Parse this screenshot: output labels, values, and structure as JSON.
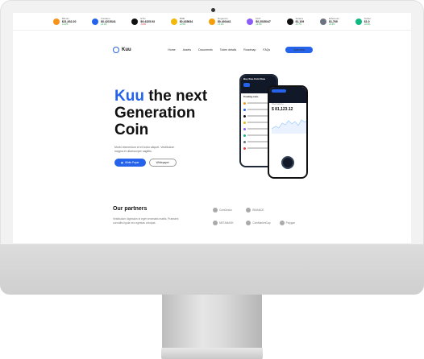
{
  "ticker": [
    {
      "icon": "bitcoin-icon",
      "color": "#f7931a",
      "name": "Bitcoin",
      "price": "$21,932.20",
      "change": "+1.2%",
      "neg": false
    },
    {
      "icon": "cardano-icon",
      "color": "#2563eb",
      "name": "Cardano",
      "price": "$0.4215341",
      "change": "+2.1%",
      "neg": false
    },
    {
      "icon": "ethereum-dark-icon",
      "color": "#111111",
      "name": "ETH",
      "price": "$9.4325.93",
      "change": "-0.8%",
      "neg": true
    },
    {
      "icon": "binance-icon",
      "color": "#f0b90b",
      "name": "BNB",
      "price": "$0.435634",
      "change": "+0.5%",
      "neg": false
    },
    {
      "icon": "dogecoin-icon",
      "color": "#f59e0b",
      "name": "Dogecoin",
      "price": "$0.403441",
      "change": "+1.1%",
      "neg": false
    },
    {
      "icon": "polkadot-icon",
      "color": "#8b5cf6",
      "name": "DOT",
      "price": "$0.2035347",
      "change": "+0.9%",
      "neg": false
    },
    {
      "icon": "solana-icon",
      "color": "#111111",
      "name": "Solana",
      "price": "$1.109",
      "change": "+1.7%",
      "neg": false
    },
    {
      "icon": "ethereum-icon",
      "color": "#6b7280",
      "name": "Ethereum",
      "price": "$1,769",
      "change": "+0.3%",
      "neg": false
    },
    {
      "icon": "tether-icon",
      "color": "#10b981",
      "name": "Tether",
      "price": "$1.0",
      "change": "+0.0%",
      "neg": false
    }
  ],
  "nav": {
    "logo": "Kuu",
    "items": [
      "Home",
      "Assets",
      "Documents",
      "Token details",
      "Roadmap",
      "FAQs"
    ],
    "cta": "Join now"
  },
  "hero": {
    "title_accent": "Kuu",
    "title_rest_1": " the next",
    "title_rest_2": "Generation",
    "title_rest_3": "Coin",
    "description": "Morbi elementum et et tortor aliquet. Vestibulum magna et ullamcorper sagittis.",
    "primary_btn": "White Paper",
    "secondary_btn": "Whitepaper"
  },
  "phone_back": {
    "head": "Buy Kuu Coin Now",
    "list_title": "Trending coins"
  },
  "phone_front": {
    "price": "$ 81,123.12",
    "sub": "Total balance"
  },
  "partners": {
    "title": "Our partners",
    "description": "Vestibulum dignissim in eget venenatis mattis. Praesent convallis ligula nec egestas volutpat.",
    "logos": [
      {
        "name": "CoinGecko",
        "icon": "coingecko-icon"
      },
      {
        "name": "BINANCE",
        "icon": "binance-logo-icon"
      },
      {
        "name": "",
        "icon": "blank"
      },
      {
        "name": "METAMASK",
        "icon": "metamask-icon"
      },
      {
        "name": "CoinMarketCap",
        "icon": "coinmarketcap-icon"
      },
      {
        "name": "Polygon",
        "icon": "polygon-icon"
      }
    ]
  },
  "colors": {
    "accent": "#2563eb"
  }
}
